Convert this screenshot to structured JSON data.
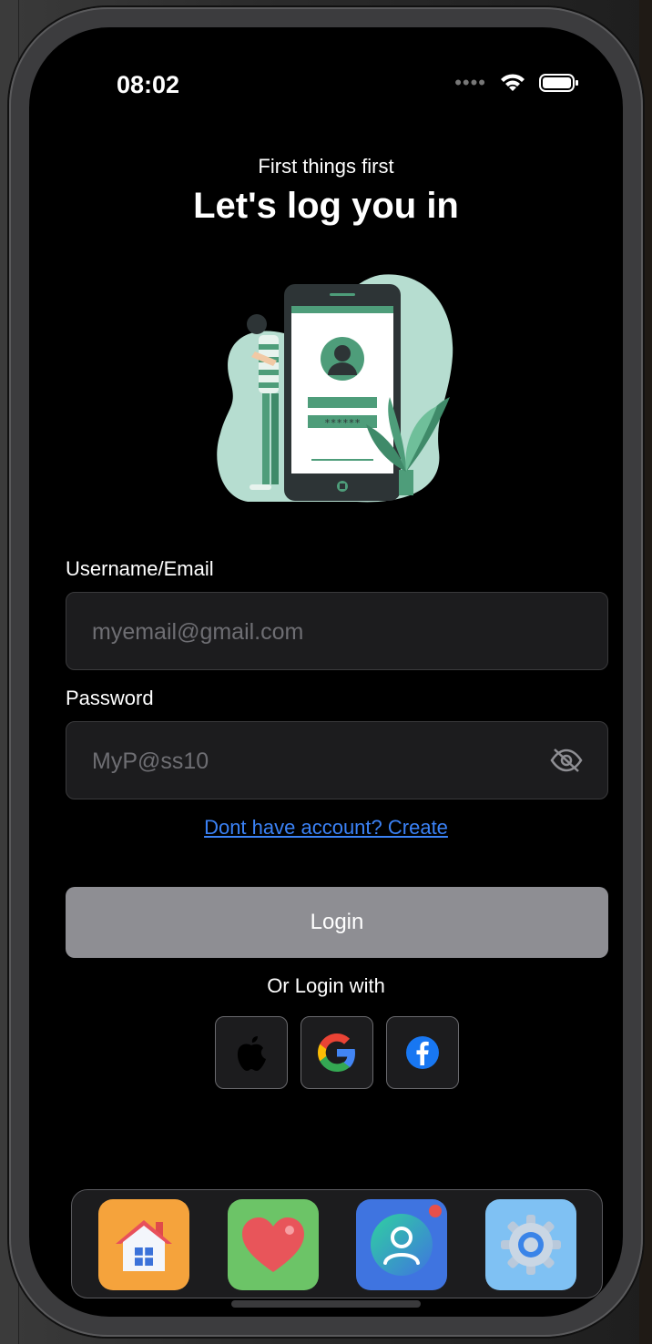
{
  "status_bar": {
    "time": "08:02"
  },
  "header": {
    "subtitle": "First things first",
    "title": "Let's log you in"
  },
  "illustration": {
    "password_mask": "******"
  },
  "form": {
    "username_label": "Username/Email",
    "username_placeholder": "myemail@gmail.com",
    "password_label": "Password",
    "password_placeholder": "MyP@ss10",
    "create_link": "Dont have account? Create",
    "login_button": "Login",
    "or_text": "Or Login with"
  },
  "social": [
    "apple-icon",
    "google-icon",
    "facebook-icon"
  ],
  "dock": {
    "apps": [
      {
        "icon": "home-icon",
        "color": "#f5a33c"
      },
      {
        "icon": "heart-icon",
        "color": "#6cc467"
      },
      {
        "icon": "profile-icon",
        "color": "#3f74e0"
      },
      {
        "icon": "gear-icon",
        "color": "#7fc1f3"
      }
    ]
  },
  "colors": {
    "accent_green": "#4e9d7a",
    "link": "#3b82f6",
    "button_gray": "#8e8e93"
  }
}
